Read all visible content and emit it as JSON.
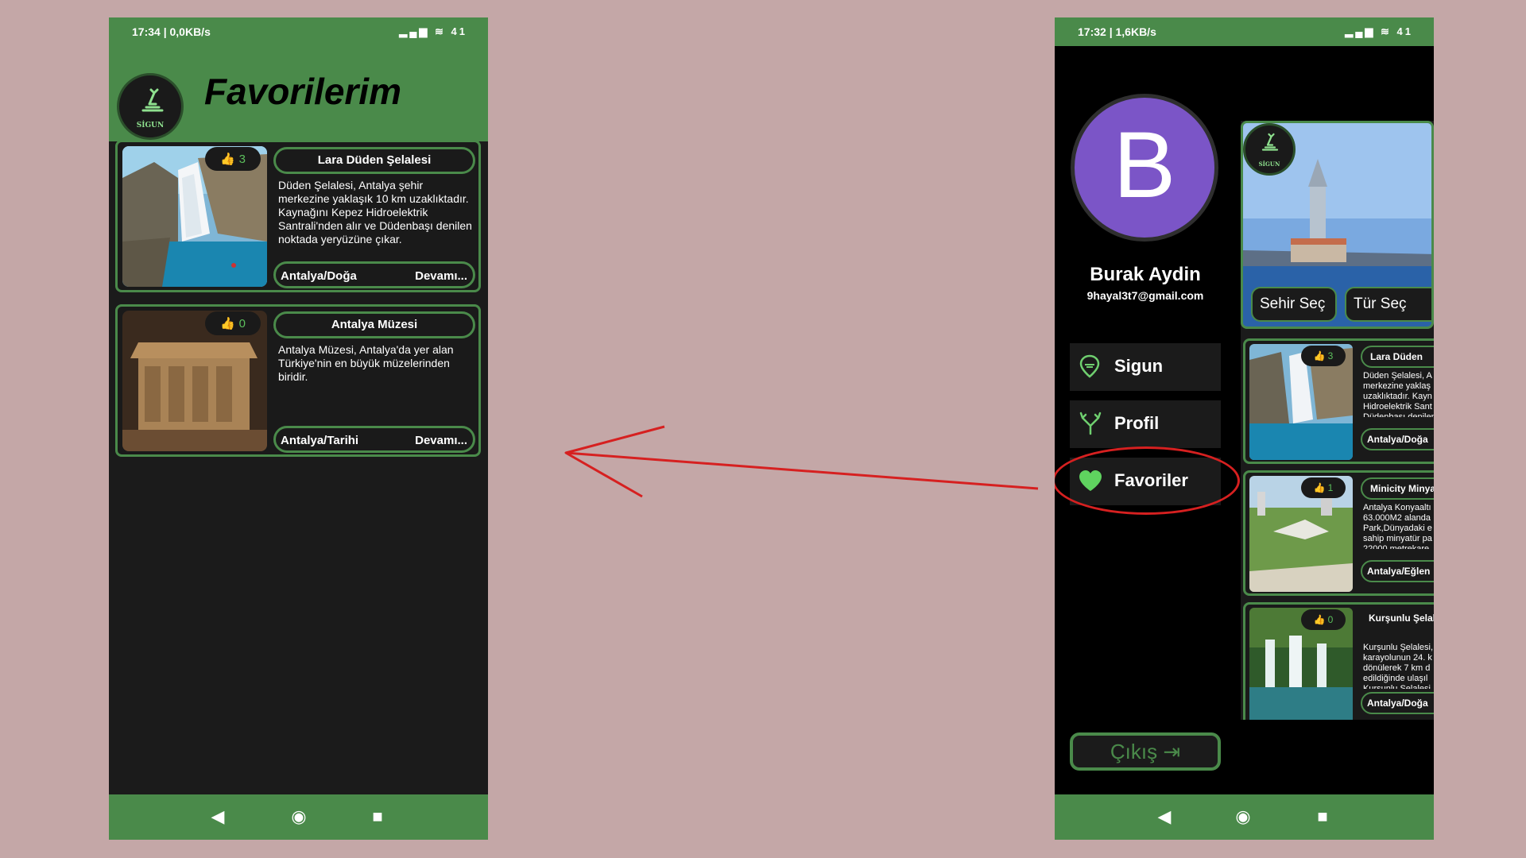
{
  "left_phone": {
    "status": {
      "time": "17:34 | 0,0KB/s",
      "icons": "▂▄▆ ≋ 41"
    },
    "logo_text": "SİGUN",
    "title": "Favorilerim",
    "cards": [
      {
        "likes": "3",
        "title": "Lara Düden Şelalesi",
        "description": "Düden Şelalesi, Antalya şehir merkezine yaklaşık 10 km uzaklıktadır. Kaynağını Kepez Hidroelektrik Santrali'nden alır ve Düdenbaşı denilen noktada yeryüzüne çıkar.",
        "location": "Antalya/Doğa",
        "more": "Devamı..."
      },
      {
        "likes": "0",
        "title": "Antalya Müzesi",
        "description": "Antalya Müzesi, Antalya'da yer alan Türkiye'nin en büyük müzelerinden biridir.",
        "location": "Antalya/Tarihi",
        "more": "Devamı..."
      }
    ],
    "nav": {
      "back": "◀",
      "home": "◉",
      "recent": "■"
    }
  },
  "right_phone": {
    "status": {
      "time": "17:32 | 1,6KB/s",
      "icons": "▂▄▆ ≋ 41"
    },
    "avatar_letter": "B",
    "user_name": "Burak Aydin",
    "user_email": "9hayal3t7@gmail.com",
    "menu": [
      {
        "label": "Sigun",
        "icon": "map-pin-icon"
      },
      {
        "label": "Profil",
        "icon": "antlers-icon"
      },
      {
        "label": "Favoriler",
        "icon": "heart-icon"
      }
    ],
    "logout_label": "Çıkış",
    "behind": {
      "logo_text": "SİGUN",
      "city_select": "Sehir Seç",
      "type_select": "Tür Seç",
      "cards": [
        {
          "likes": "3",
          "title": "Lara Düden",
          "description": "Düden Şelalesi, A merkezine yaklaş uzaklıktadır. Kayn Hidroelektrik Sant Düdenbaşı denilen",
          "location": "Antalya/Doğa"
        },
        {
          "likes": "1",
          "title": "Minicity Minyat",
          "description": "Antalya Konyaaltı 63.000M2 alanda Park,Dünyadaki e sahip minyatür pa 22000 metrekare",
          "location": "Antalya/Eğlen"
        },
        {
          "likes": "0",
          "title": "Kurşunlu Şelale Parkı",
          "description": "Kurşunlu Şelalesi, karayolunun 24. k dönülerek 7 km d edildiğinde ulaşıl Kurşunlu Şelalesi",
          "location": "Antalya/Doğa"
        }
      ]
    },
    "nav": {
      "back": "◀",
      "home": "◉",
      "recent": "■"
    }
  },
  "colors": {
    "app_green": "#4a8a4a",
    "annotation_red": "#d62020",
    "background": "#c4a7a7",
    "avatar": "#7b55c7"
  }
}
